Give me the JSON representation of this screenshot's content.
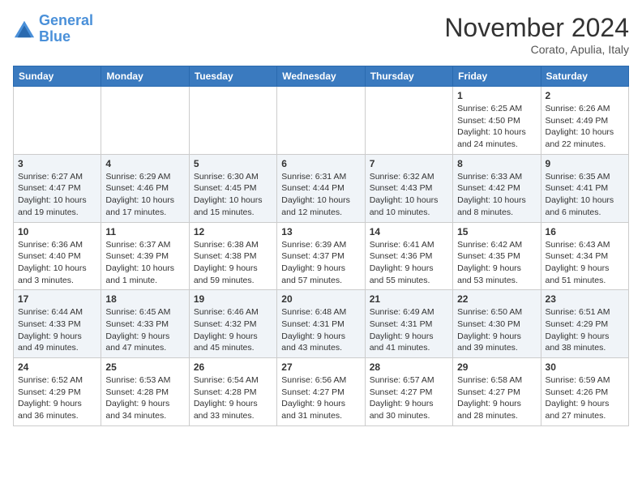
{
  "header": {
    "logo_line1": "General",
    "logo_line2": "Blue",
    "month": "November 2024",
    "location": "Corato, Apulia, Italy"
  },
  "weekdays": [
    "Sunday",
    "Monday",
    "Tuesday",
    "Wednesday",
    "Thursday",
    "Friday",
    "Saturday"
  ],
  "weeks": [
    [
      {
        "day": "",
        "info": ""
      },
      {
        "day": "",
        "info": ""
      },
      {
        "day": "",
        "info": ""
      },
      {
        "day": "",
        "info": ""
      },
      {
        "day": "",
        "info": ""
      },
      {
        "day": "1",
        "info": "Sunrise: 6:25 AM\nSunset: 4:50 PM\nDaylight: 10 hours and 24 minutes."
      },
      {
        "day": "2",
        "info": "Sunrise: 6:26 AM\nSunset: 4:49 PM\nDaylight: 10 hours and 22 minutes."
      }
    ],
    [
      {
        "day": "3",
        "info": "Sunrise: 6:27 AM\nSunset: 4:47 PM\nDaylight: 10 hours and 19 minutes."
      },
      {
        "day": "4",
        "info": "Sunrise: 6:29 AM\nSunset: 4:46 PM\nDaylight: 10 hours and 17 minutes."
      },
      {
        "day": "5",
        "info": "Sunrise: 6:30 AM\nSunset: 4:45 PM\nDaylight: 10 hours and 15 minutes."
      },
      {
        "day": "6",
        "info": "Sunrise: 6:31 AM\nSunset: 4:44 PM\nDaylight: 10 hours and 12 minutes."
      },
      {
        "day": "7",
        "info": "Sunrise: 6:32 AM\nSunset: 4:43 PM\nDaylight: 10 hours and 10 minutes."
      },
      {
        "day": "8",
        "info": "Sunrise: 6:33 AM\nSunset: 4:42 PM\nDaylight: 10 hours and 8 minutes."
      },
      {
        "day": "9",
        "info": "Sunrise: 6:35 AM\nSunset: 4:41 PM\nDaylight: 10 hours and 6 minutes."
      }
    ],
    [
      {
        "day": "10",
        "info": "Sunrise: 6:36 AM\nSunset: 4:40 PM\nDaylight: 10 hours and 3 minutes."
      },
      {
        "day": "11",
        "info": "Sunrise: 6:37 AM\nSunset: 4:39 PM\nDaylight: 10 hours and 1 minute."
      },
      {
        "day": "12",
        "info": "Sunrise: 6:38 AM\nSunset: 4:38 PM\nDaylight: 9 hours and 59 minutes."
      },
      {
        "day": "13",
        "info": "Sunrise: 6:39 AM\nSunset: 4:37 PM\nDaylight: 9 hours and 57 minutes."
      },
      {
        "day": "14",
        "info": "Sunrise: 6:41 AM\nSunset: 4:36 PM\nDaylight: 9 hours and 55 minutes."
      },
      {
        "day": "15",
        "info": "Sunrise: 6:42 AM\nSunset: 4:35 PM\nDaylight: 9 hours and 53 minutes."
      },
      {
        "day": "16",
        "info": "Sunrise: 6:43 AM\nSunset: 4:34 PM\nDaylight: 9 hours and 51 minutes."
      }
    ],
    [
      {
        "day": "17",
        "info": "Sunrise: 6:44 AM\nSunset: 4:33 PM\nDaylight: 9 hours and 49 minutes."
      },
      {
        "day": "18",
        "info": "Sunrise: 6:45 AM\nSunset: 4:33 PM\nDaylight: 9 hours and 47 minutes."
      },
      {
        "day": "19",
        "info": "Sunrise: 6:46 AM\nSunset: 4:32 PM\nDaylight: 9 hours and 45 minutes."
      },
      {
        "day": "20",
        "info": "Sunrise: 6:48 AM\nSunset: 4:31 PM\nDaylight: 9 hours and 43 minutes."
      },
      {
        "day": "21",
        "info": "Sunrise: 6:49 AM\nSunset: 4:31 PM\nDaylight: 9 hours and 41 minutes."
      },
      {
        "day": "22",
        "info": "Sunrise: 6:50 AM\nSunset: 4:30 PM\nDaylight: 9 hours and 39 minutes."
      },
      {
        "day": "23",
        "info": "Sunrise: 6:51 AM\nSunset: 4:29 PM\nDaylight: 9 hours and 38 minutes."
      }
    ],
    [
      {
        "day": "24",
        "info": "Sunrise: 6:52 AM\nSunset: 4:29 PM\nDaylight: 9 hours and 36 minutes."
      },
      {
        "day": "25",
        "info": "Sunrise: 6:53 AM\nSunset: 4:28 PM\nDaylight: 9 hours and 34 minutes."
      },
      {
        "day": "26",
        "info": "Sunrise: 6:54 AM\nSunset: 4:28 PM\nDaylight: 9 hours and 33 minutes."
      },
      {
        "day": "27",
        "info": "Sunrise: 6:56 AM\nSunset: 4:27 PM\nDaylight: 9 hours and 31 minutes."
      },
      {
        "day": "28",
        "info": "Sunrise: 6:57 AM\nSunset: 4:27 PM\nDaylight: 9 hours and 30 minutes."
      },
      {
        "day": "29",
        "info": "Sunrise: 6:58 AM\nSunset: 4:27 PM\nDaylight: 9 hours and 28 minutes."
      },
      {
        "day": "30",
        "info": "Sunrise: 6:59 AM\nSunset: 4:26 PM\nDaylight: 9 hours and 27 minutes."
      }
    ]
  ]
}
